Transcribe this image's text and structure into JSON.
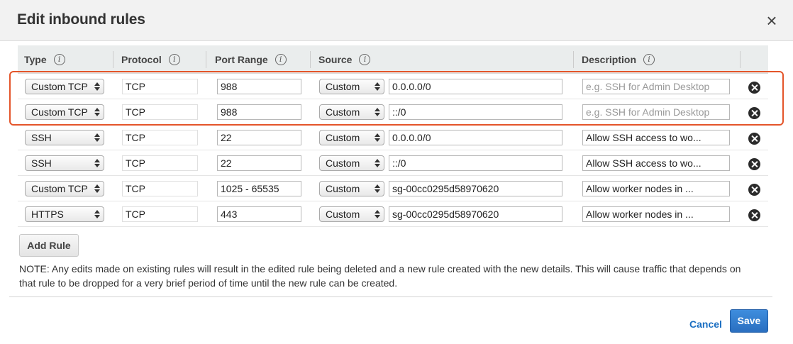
{
  "dialog": {
    "title": "Edit inbound rules",
    "close_glyph": "×"
  },
  "table": {
    "headers": {
      "type": "Type",
      "protocol": "Protocol",
      "port_range": "Port Range",
      "source": "Source",
      "description": "Description"
    },
    "info_glyph": "i",
    "rows": [
      {
        "type": "Custom TCP Rule",
        "protocol": "TCP",
        "port": "988",
        "source_type": "Custom",
        "source": "0.0.0.0/0",
        "description": "",
        "description_placeholder": "e.g. SSH for Admin Desktop"
      },
      {
        "type": "Custom TCP Rule",
        "protocol": "TCP",
        "port": "988",
        "source_type": "Custom",
        "source": "::/0",
        "description": "",
        "description_placeholder": "e.g. SSH for Admin Desktop"
      },
      {
        "type": "SSH",
        "protocol": "TCP",
        "port": "22",
        "source_type": "Custom",
        "source": "0.0.0.0/0",
        "description": "Allow SSH access to wo...",
        "description_placeholder": ""
      },
      {
        "type": "SSH",
        "protocol": "TCP",
        "port": "22",
        "source_type": "Custom",
        "source": "::/0",
        "description": "Allow SSH access to wo...",
        "description_placeholder": ""
      },
      {
        "type": "Custom TCP Rule",
        "protocol": "TCP",
        "port": "1025 - 65535",
        "source_type": "Custom",
        "source": "sg-00cc0295d58970620",
        "description": "Allow worker nodes in ...",
        "description_placeholder": ""
      },
      {
        "type": "HTTPS",
        "protocol": "TCP",
        "port": "443",
        "source_type": "Custom",
        "source": "sg-00cc0295d58970620",
        "description": "Allow worker nodes in ...",
        "description_placeholder": ""
      }
    ]
  },
  "actions": {
    "add_rule": "Add Rule",
    "cancel": "Cancel",
    "save": "Save"
  },
  "note": "NOTE: Any edits made on existing rules will result in the edited rule being deleted and a new rule created with the new details. This will cause traffic that depends on that rule to be dropped for a very brief period of time until the new rule can be created.",
  "colors": {
    "highlight": "#e4552a",
    "primary_button": "#2a6fc0",
    "link": "#1b6fc2"
  }
}
